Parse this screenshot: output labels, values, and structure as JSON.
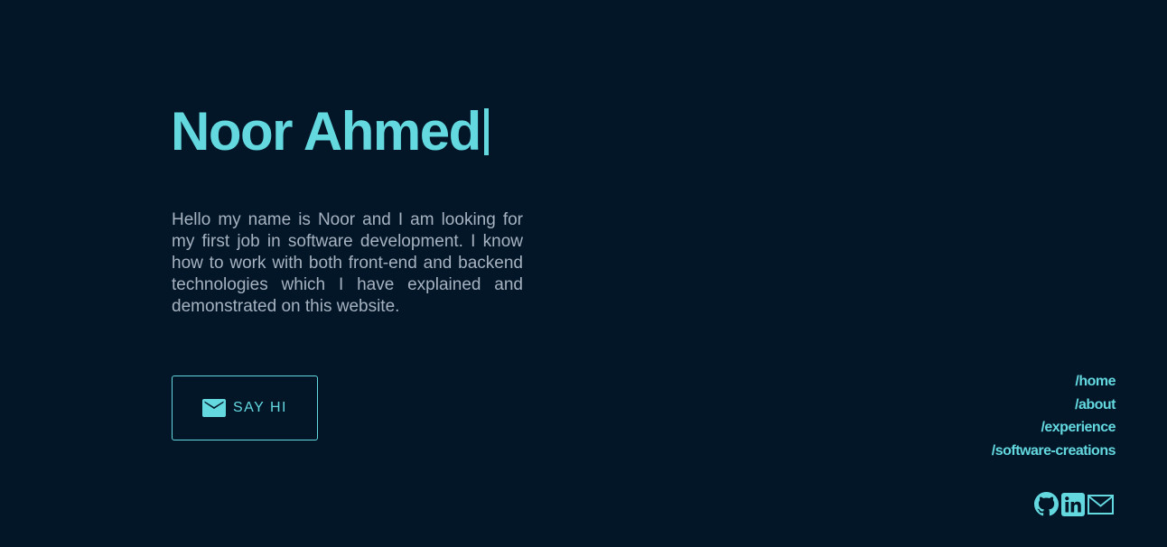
{
  "hero": {
    "name": "Noor Ahmed",
    "cursor_glyph": "|",
    "intro": "Hello my name is Noor and I am looking for my first job in software development. I know how to work with both front-end and backend technologies which I have explained and demonstrated on this website."
  },
  "cta": {
    "label": "SAY HI",
    "icon": "envelope-icon"
  },
  "nav": {
    "items": [
      {
        "label": "/home"
      },
      {
        "label": "/about"
      },
      {
        "label": "/experience"
      },
      {
        "label": "/software-creations"
      }
    ]
  },
  "socials": [
    {
      "icon": "github-icon"
    },
    {
      "icon": "linkedin-icon"
    },
    {
      "icon": "mail-icon"
    }
  ],
  "colors": {
    "background": "#021628",
    "accent": "#64d8df",
    "body_text": "#a6b2c0"
  }
}
